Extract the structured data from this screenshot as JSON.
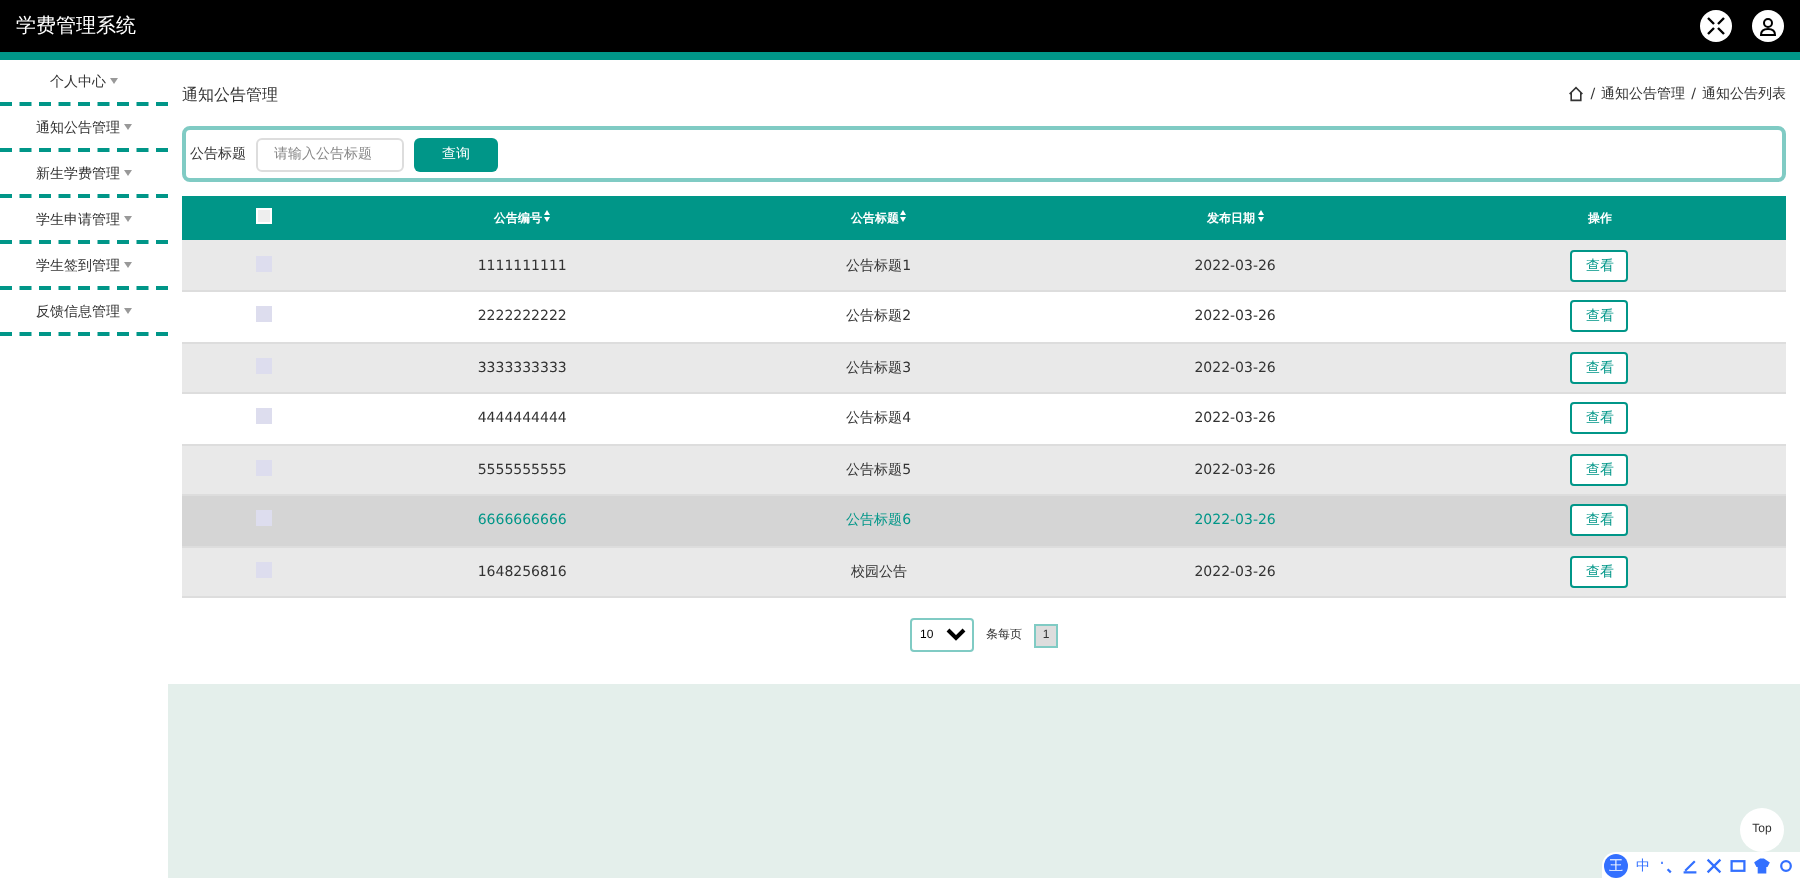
{
  "header": {
    "title": "学费管理系统"
  },
  "sidebar": {
    "items": [
      {
        "label": "个人中心",
        "selected": false
      },
      {
        "label": "通知公告管理",
        "selected": false
      },
      {
        "label": "新生学费管理",
        "selected": false
      },
      {
        "label": "学生申请管理",
        "selected": false
      },
      {
        "label": "学生签到管理",
        "selected": false
      },
      {
        "label": "反馈信息管理",
        "selected": false
      }
    ]
  },
  "page_title": "通知公告管理",
  "breadcrumb": [
    "通知公告管理",
    "通知公告列表"
  ],
  "breadcrumb_separator": "/",
  "search": {
    "label": "公告标题",
    "placeholder": "请输入公告标题",
    "button": "查询"
  },
  "table": {
    "columns": [
      "公告编号",
      "公告标题",
      "发布日期",
      "操作"
    ],
    "select_all_checked": false,
    "rows": [
      {
        "cells": [
          "1111111111",
          "公告标题1",
          "2022-03-26"
        ],
        "action": "查看",
        "checked": false,
        "hovered": false
      },
      {
        "cells": [
          "2222222222",
          "公告标题2",
          "2022-03-26"
        ],
        "action": "查看",
        "checked": false,
        "hovered": false
      },
      {
        "cells": [
          "3333333333",
          "公告标题3",
          "2022-03-26"
        ],
        "action": "查看",
        "checked": false,
        "hovered": false
      },
      {
        "cells": [
          "4444444444",
          "公告标题4",
          "2022-03-26"
        ],
        "action": "查看",
        "checked": false,
        "hovered": false
      },
      {
        "cells": [
          "5555555555",
          "公告标题5",
          "2022-03-26"
        ],
        "action": "查看",
        "checked": false,
        "hovered": false
      },
      {
        "cells": [
          "6666666666",
          "公告标题6",
          "2022-03-26"
        ],
        "action": "查看",
        "checked": false,
        "hovered": true
      },
      {
        "cells": [
          "1648256816",
          "校园公告",
          "2022-03-26"
        ],
        "action": "查看",
        "checked": false,
        "hovered": false
      }
    ]
  },
  "pagination": {
    "page_size": "10",
    "per_page_label": "条每页",
    "pages": [
      {
        "label": "1",
        "selected": true
      }
    ]
  },
  "top_button": "Top",
  "ime_bar": {
    "logo": "王",
    "mode": "中"
  }
}
